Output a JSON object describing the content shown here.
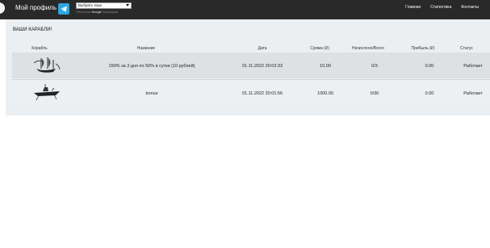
{
  "header": {
    "brand": "Мой профиль",
    "language_select": "Выбрать язык",
    "powered_by_prefix": "Технологии",
    "powered_by_service": "Google",
    "powered_by_suffix": "Переводчик",
    "nav": [
      "Главная",
      "Статистика",
      "Контакты"
    ]
  },
  "main": {
    "title": "ВАШИ КАРАБЛИ!",
    "columns": [
      "Корабль",
      "Название",
      "Дата",
      "Сумма (₽)",
      "Начислено/Всего",
      "Прибыль (₽)",
      "Статус"
    ],
    "rows": [
      {
        "icon": "sail-ship-icon",
        "name": "150% за 3 дня по 50% в сутки (10 рублей)",
        "date": "01.11.2022 20:02:33",
        "amount": "10.00",
        "accrued": "0/3",
        "profit": "0.00",
        "status": "Работает"
      },
      {
        "icon": "warship-icon",
        "name": "bonus",
        "date": "01.11.2022 20:01:56",
        "amount": "1000.00",
        "accrued": "0/30",
        "profit": "0.00",
        "status": "Работает"
      }
    ]
  },
  "colors": {
    "topbar": "#292929",
    "panel": "#ebeff2",
    "row_highlight": "#dde1e4",
    "telegram": "#2ca5e0"
  }
}
